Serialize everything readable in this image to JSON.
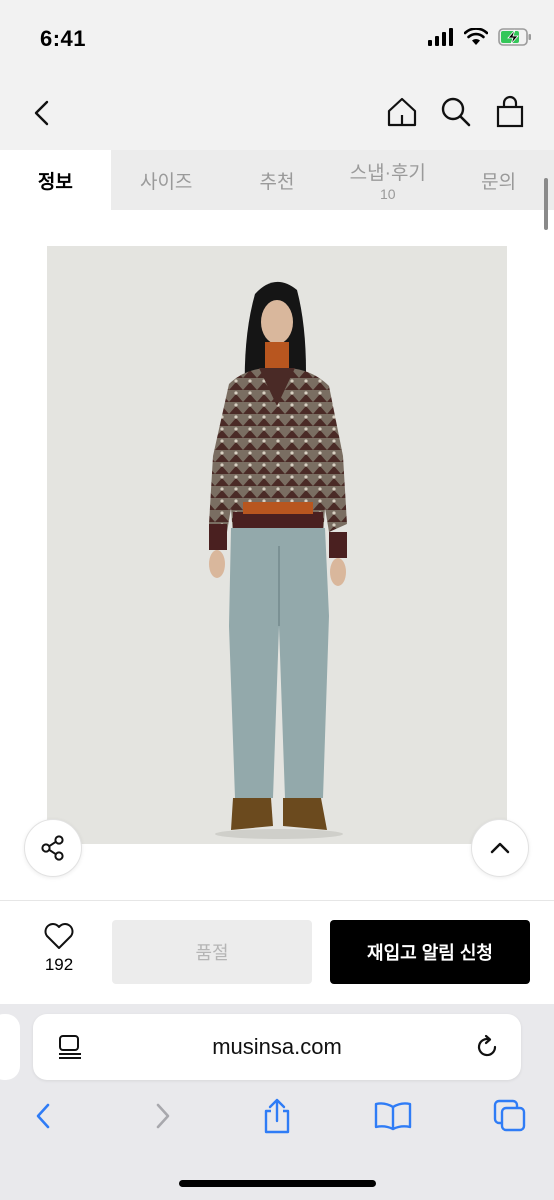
{
  "status_bar": {
    "time": "6:41"
  },
  "tabs": [
    {
      "label": "정보",
      "active": true
    },
    {
      "label": "사이즈"
    },
    {
      "label": "추천"
    },
    {
      "label": "스냅·후기",
      "count": "10"
    },
    {
      "label": "문의"
    }
  ],
  "actions": {
    "like_count": "192",
    "soldout_label": "품절",
    "restock_label": "재입고 알림 신청"
  },
  "browser": {
    "url": "musinsa.com"
  },
  "icons": {
    "back": "chevron-left-icon",
    "home": "home-icon",
    "search": "search-icon",
    "cart": "shopping-bag-icon",
    "share": "share-icon",
    "top": "chevron-up-icon",
    "like": "heart-icon"
  },
  "colors": {
    "accent_black": "#000000",
    "tab_bg": "#ececec",
    "browser_blue": "#2f7cf6"
  }
}
